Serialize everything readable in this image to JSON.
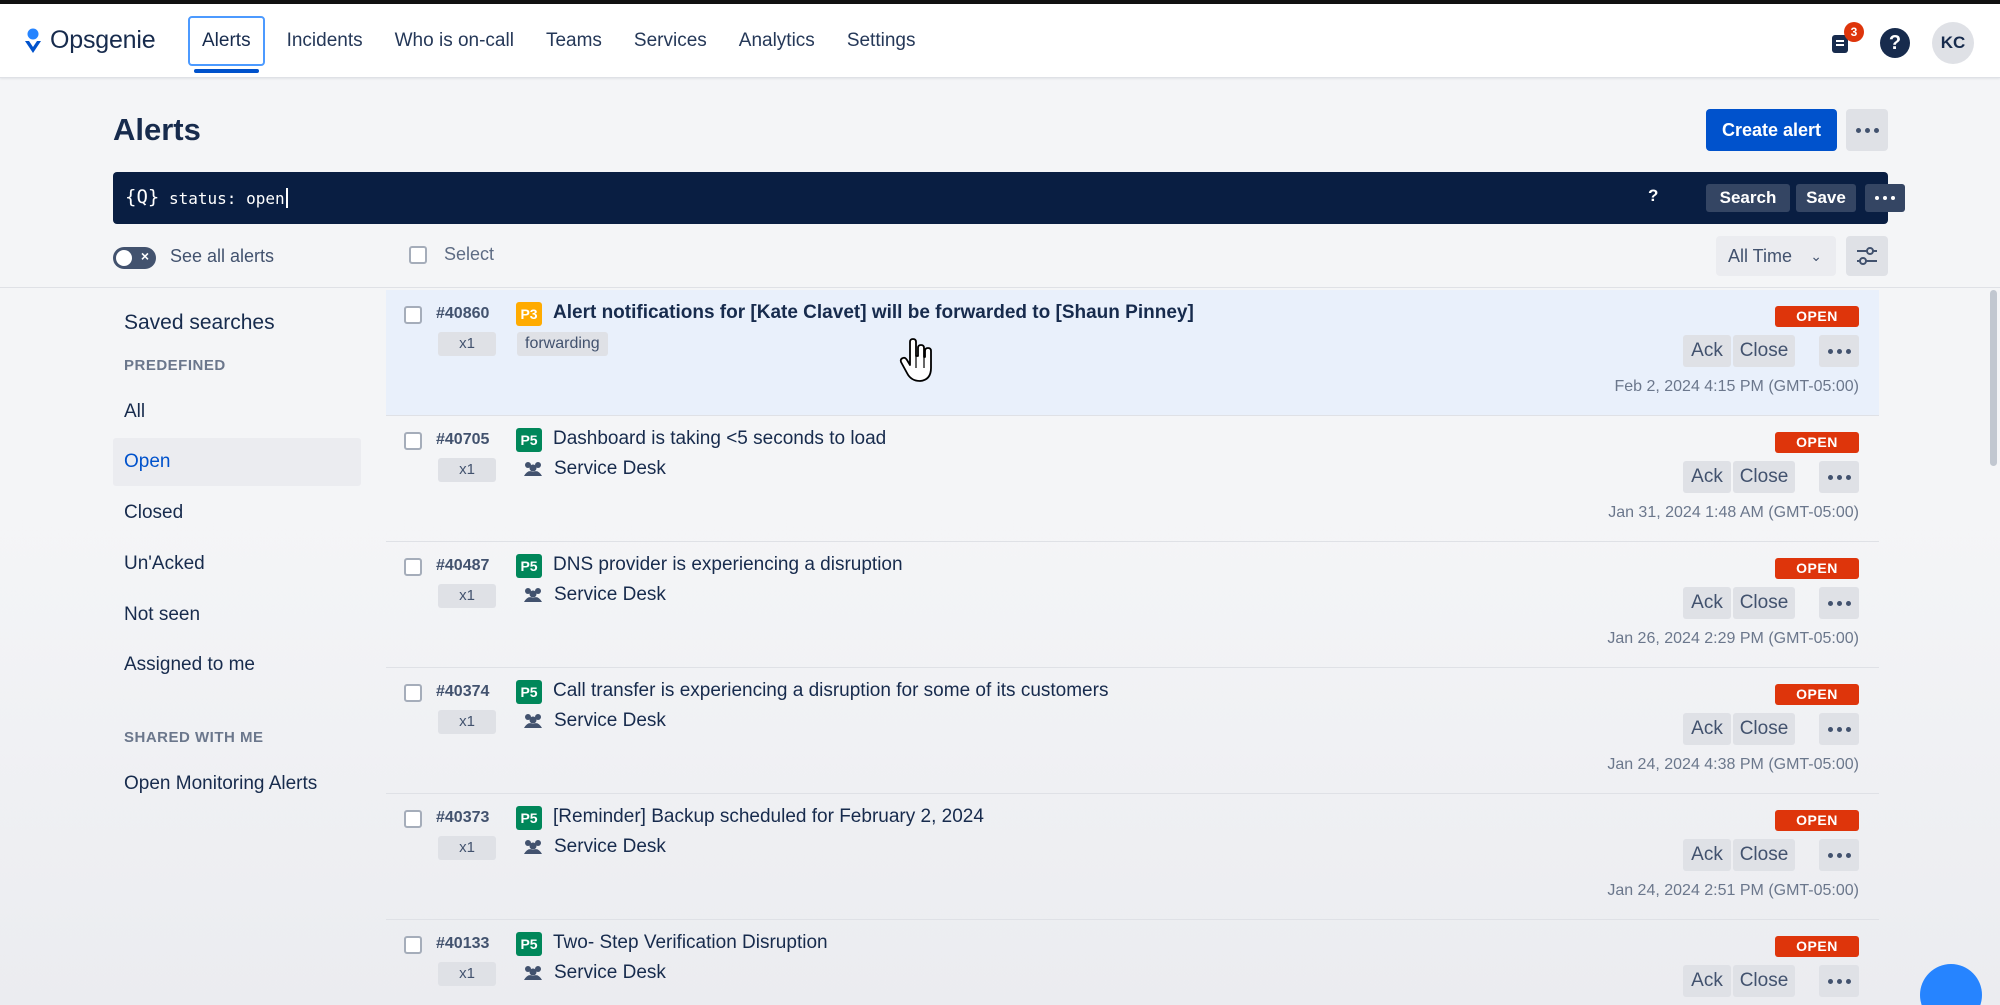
{
  "app": {
    "name": "Opsgenie",
    "nav": [
      "Alerts",
      "Incidents",
      "Who is on-call",
      "Teams",
      "Services",
      "Analytics",
      "Settings"
    ],
    "notification_count": "3",
    "help_label": "?",
    "user_initials": "KC"
  },
  "page": {
    "title": "Alerts",
    "create_label": "Create alert"
  },
  "search": {
    "icon_label": "{Q}",
    "query": "status: open",
    "help": "?",
    "search_label": "Search",
    "save_label": "Save"
  },
  "controls": {
    "see_all_label": "See all alerts",
    "select_label": "Select",
    "time_range": "All Time"
  },
  "sidebar": {
    "title": "Saved searches",
    "predefined_heading": "PREDEFINED",
    "items": [
      "All",
      "Open",
      "Closed",
      "Un'Acked",
      "Not seen",
      "Assigned to me"
    ],
    "shared_heading": "SHARED WITH ME",
    "shared_items": [
      "Open Monitoring Alerts"
    ]
  },
  "alert_actions": {
    "ack": "Ack",
    "close": "Close"
  },
  "alerts": [
    {
      "id": "#40860",
      "count": "x1",
      "priority": "P3",
      "message": "Alert notifications for [Kate Clavet] will be forwarded to [Shaun Pinney]",
      "tag": "forwarding",
      "status": "OPEN",
      "date": "Feb 2, 2024 4:15 PM (GMT-05:00)"
    },
    {
      "id": "#40705",
      "count": "x1",
      "priority": "P5",
      "message": "Dashboard is taking <5 seconds to load",
      "team": "Service Desk",
      "status": "OPEN",
      "date": "Jan 31, 2024 1:48 AM (GMT-05:00)"
    },
    {
      "id": "#40487",
      "count": "x1",
      "priority": "P5",
      "message": "DNS provider is experiencing a disruption",
      "team": "Service Desk",
      "status": "OPEN",
      "date": "Jan 26, 2024 2:29 PM (GMT-05:00)"
    },
    {
      "id": "#40374",
      "count": "x1",
      "priority": "P5",
      "message": "Call transfer is experiencing a disruption for some of its customers",
      "team": "Service Desk",
      "status": "OPEN",
      "date": "Jan 24, 2024 4:38 PM (GMT-05:00)"
    },
    {
      "id": "#40373",
      "count": "x1",
      "priority": "P5",
      "message": "[Reminder] Backup scheduled for February 2, 2024",
      "team": "Service Desk",
      "status": "OPEN",
      "date": "Jan 24, 2024 2:51 PM (GMT-05:00)"
    },
    {
      "id": "#40133",
      "count": "x1",
      "priority": "P5",
      "message": "Two- Step Verification Disruption",
      "team": "Service Desk",
      "status": "OPEN",
      "date": ""
    }
  ],
  "colors": {
    "brand": "#0052cc",
    "status_open": "#de350b",
    "p3": "#ffab00",
    "p5": "#00875a",
    "search_bg": "#091e42"
  }
}
